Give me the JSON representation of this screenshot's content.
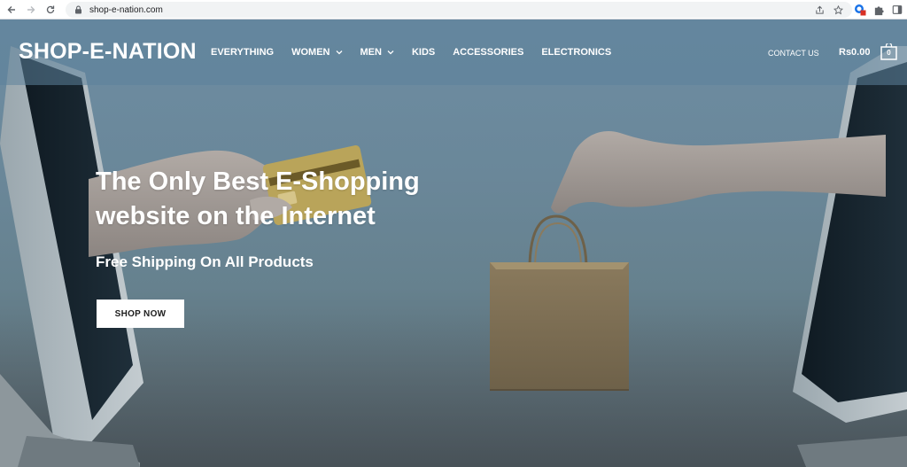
{
  "browser": {
    "url": "shop-e-nation.com",
    "icons": [
      "back-icon",
      "forward-icon",
      "reload-icon",
      "lock-icon",
      "share-icon",
      "bookmark-star-icon",
      "extension-badge-icon",
      "puzzle-icon",
      "sidebar-icon"
    ]
  },
  "header": {
    "logo": "SHOP-E-NATION",
    "nav": [
      {
        "label": "EVERYTHING",
        "has_dropdown": false
      },
      {
        "label": "WOMEN",
        "has_dropdown": true
      },
      {
        "label": "MEN",
        "has_dropdown": true
      },
      {
        "label": "KIDS",
        "has_dropdown": false
      },
      {
        "label": "ACCESSORIES",
        "has_dropdown": false
      },
      {
        "label": "ELECTRONICS",
        "has_dropdown": false
      }
    ],
    "contact": "CONTACT US",
    "cart_total": "Rs0.00",
    "cart_count": "0"
  },
  "hero": {
    "title": "The Only Best E-Shopping website on the Internet",
    "subtitle": "Free Shipping On All Products",
    "cta": "SHOP NOW"
  },
  "colors": {
    "header_overlay": "#5c829b",
    "hero_sky": "#6d8da3",
    "button_bg": "#ffffff",
    "text": "#ffffff"
  }
}
